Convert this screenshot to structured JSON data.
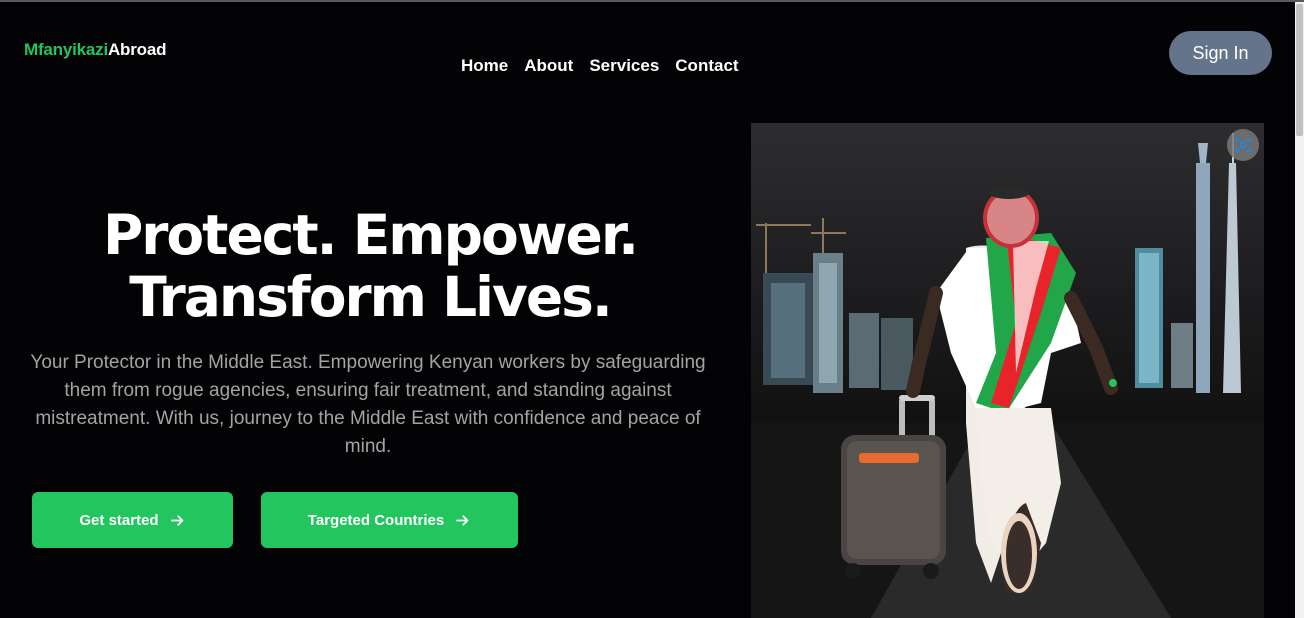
{
  "brand": {
    "part1": "Mfanyikazi",
    "part2": "Abroad",
    "accent_color": "#22c55e"
  },
  "nav": {
    "items": [
      "Home",
      "About",
      "Services",
      "Contact"
    ]
  },
  "auth": {
    "signin_label": "Sign In",
    "signin_color": "#64748b"
  },
  "hero": {
    "title_line1": "Protect. Empower.",
    "title_line2": "Transform Lives.",
    "subtitle": "Your Protector in the Middle East. Empowering Kenyan workers by safeguarding them from rogue agencies, ensuring fair treatment, and standing against mistreatment. With us, journey to the Middle East with confidence and peace of mind.",
    "cta_primary": "Get started",
    "cta_secondary": "Targeted Countries",
    "cta_icon": "arrow-right-icon"
  },
  "image": {
    "lens_icon": "visual-search-icon"
  }
}
